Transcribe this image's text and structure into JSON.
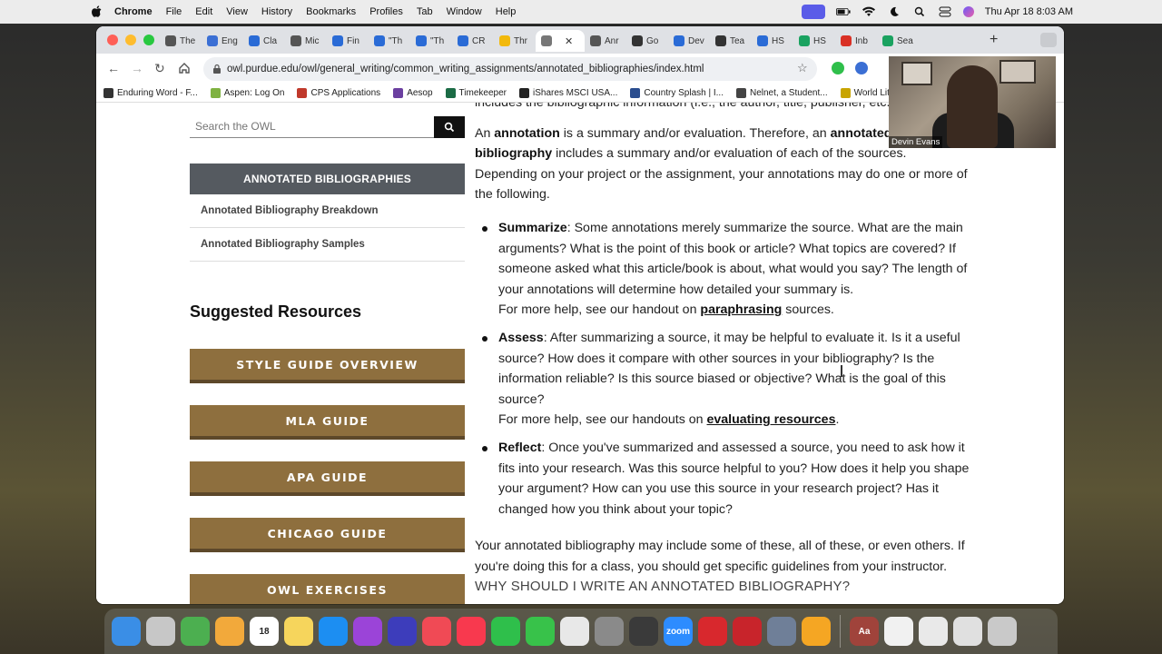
{
  "menubar": {
    "app_name": "Chrome",
    "menus": [
      "File",
      "Edit",
      "View",
      "History",
      "Bookmarks",
      "Profiles",
      "Tab",
      "Window",
      "Help"
    ],
    "datetime": "Thu Apr 18  8:03 AM"
  },
  "browser": {
    "tabs": [
      {
        "label": "The",
        "color": "#555"
      },
      {
        "label": "Eng",
        "color": "#3b6fd4"
      },
      {
        "label": "Cla",
        "color": "#2a6bd6"
      },
      {
        "label": "Mic",
        "color": "#555"
      },
      {
        "label": "Fin",
        "color": "#2a6bd6"
      },
      {
        "label": "\"Th",
        "color": "#2a6bd6"
      },
      {
        "label": "\"Th",
        "color": "#2a6bd6"
      },
      {
        "label": "CR",
        "color": "#2a6bd6"
      },
      {
        "label": "Thr",
        "color": "#f2b90c"
      },
      {
        "label": "",
        "color": "#777",
        "active": true
      },
      {
        "label": "Anr",
        "color": "#555"
      },
      {
        "label": "Go",
        "color": "#333"
      },
      {
        "label": "Dev",
        "color": "#2a6bd6"
      },
      {
        "label": "Tea",
        "color": "#333"
      },
      {
        "label": "HS",
        "color": "#2a6bd6"
      },
      {
        "label": "HS",
        "color": "#1aa260"
      },
      {
        "label": "Inb",
        "color": "#d93025"
      },
      {
        "label": "Sea",
        "color": "#1aa260"
      }
    ],
    "url": "owl.purdue.edu/owl/general_writing/common_writing_assignments/annotated_bibliographies/index.html",
    "bookmarks": [
      {
        "label": "Enduring Word - F...",
        "color": "#333"
      },
      {
        "label": "Aspen: Log On",
        "color": "#7fb241"
      },
      {
        "label": "CPS Applications",
        "color": "#c0392b"
      },
      {
        "label": "Aesop",
        "color": "#6b3fa0"
      },
      {
        "label": "Timekeeper",
        "color": "#1b6b45"
      },
      {
        "label": "iShares MSCI USA...",
        "color": "#222"
      },
      {
        "label": "Country Splash | I...",
        "color": "#2a4d8f"
      },
      {
        "label": "Nelnet, a Student...",
        "color": "#444"
      },
      {
        "label": "World Literature",
        "color": "#c8a400"
      }
    ]
  },
  "sidebar": {
    "search_placeholder": "Search the OWL",
    "section_title": "ANNOTATED BIBLIOGRAPHIES",
    "links": [
      "Annotated Bibliography Breakdown",
      "Annotated Bibliography Samples"
    ],
    "suggested_title": "Suggested Resources",
    "resource_buttons": [
      "STYLE GUIDE OVERVIEW",
      "MLA GUIDE",
      "APA GUIDE",
      "CHICAGO GUIDE",
      "OWL EXERCISES"
    ]
  },
  "content": {
    "partial_top_line": "includes the bibliographic information (i.e., the author, title, publisher, etc.",
    "intro": {
      "p1": "An ",
      "b1": "annotation",
      "p2": " is a summary and/or evaluation. Therefore, an ",
      "b2": "annotated bibliography",
      "p3": " includes a summary and/or evaluation of each of the sources. Depending on your project or the assignment, your annotations may do one or more of the following."
    },
    "bullets": [
      {
        "term": "Summarize",
        "text": ": Some annotations merely summarize the source. What are the main arguments? What is the point of this book or article? What topics are covered? If someone asked what this article/book is about, what would you say? The length of your annotations will determine how detailed your summary is.",
        "help_pre": "For more help, see our handout on ",
        "help_link": "paraphrasing",
        "help_post": " sources."
      },
      {
        "term": "Assess",
        "text": ": After summarizing a source, it may be helpful to evaluate it. Is it a useful source? How does it compare with other sources in your bibliography? Is the information reliable? Is this source biased or objective? What is the goal of this source?",
        "help_pre": "For more help, see our handouts on ",
        "help_link": "evaluating resources",
        "help_post": "."
      },
      {
        "term": "Reflect",
        "text": ": Once you've summarized and assessed a source, you need to ask how it fits into your research. Was this source helpful to you? How does it help you shape your argument? How can you use this source in your research project? Has it changed how you think about your topic?"
      }
    ],
    "closing": "Your annotated bibliography may include some of these, all of these, or even others. If you're doing this for a class, you should get specific guidelines from your instructor.",
    "next_heading": "WHY SHOULD I WRITE AN ANNOTATED BIBLIOGRAPHY?"
  },
  "webcam": {
    "name": "Devin Evans"
  },
  "dock": {
    "apps": [
      {
        "name": "finder-icon",
        "color": "#3a8ee6"
      },
      {
        "name": "launchpad-icon",
        "color": "#c7c7c7"
      },
      {
        "name": "maps-icon",
        "color": "#4caf50"
      },
      {
        "name": "photos-icon",
        "color": "#f2a93b"
      },
      {
        "name": "calendar-icon",
        "color": "#ffffff",
        "label": "18"
      },
      {
        "name": "notes-icon",
        "color": "#f6d55c"
      },
      {
        "name": "app-store-icon",
        "color": "#1c8ef2"
      },
      {
        "name": "podcasts-icon",
        "color": "#9b44d8"
      },
      {
        "name": "imovie-icon",
        "color": "#3d3dbb"
      },
      {
        "name": "news-icon",
        "color": "#f04a55"
      },
      {
        "name": "music-icon",
        "color": "#f8394e"
      },
      {
        "name": "facetime-icon",
        "color": "#2fbf4b"
      },
      {
        "name": "messages-icon",
        "color": "#38c24a"
      },
      {
        "name": "chrome-icon",
        "color": "#e8e8e8"
      },
      {
        "name": "system-settings-icon",
        "color": "#8a8a8a"
      },
      {
        "name": "calculator-icon",
        "color": "#3a3a3a"
      },
      {
        "name": "zoom-icon",
        "color": "#2d8cff",
        "label": "zoom"
      },
      {
        "name": "shield-app-icon",
        "color": "#d8282d"
      },
      {
        "name": "photo-booth-icon",
        "color": "#c8242b"
      },
      {
        "name": "preview-icon",
        "color": "#6f7f98"
      },
      {
        "name": "pages-icon",
        "color": "#f5a623"
      },
      {
        "name": "dictionary-icon",
        "color": "#a0433b",
        "label": "Aa"
      },
      {
        "name": "document-icon",
        "color": "#f1f1f1"
      },
      {
        "name": "screenshot-stack-icon",
        "color": "#e9e9e9"
      },
      {
        "name": "screenshot-stack-2-icon",
        "color": "#e0e0e0"
      },
      {
        "name": "trash-icon",
        "color": "#c9c9c9"
      }
    ]
  }
}
